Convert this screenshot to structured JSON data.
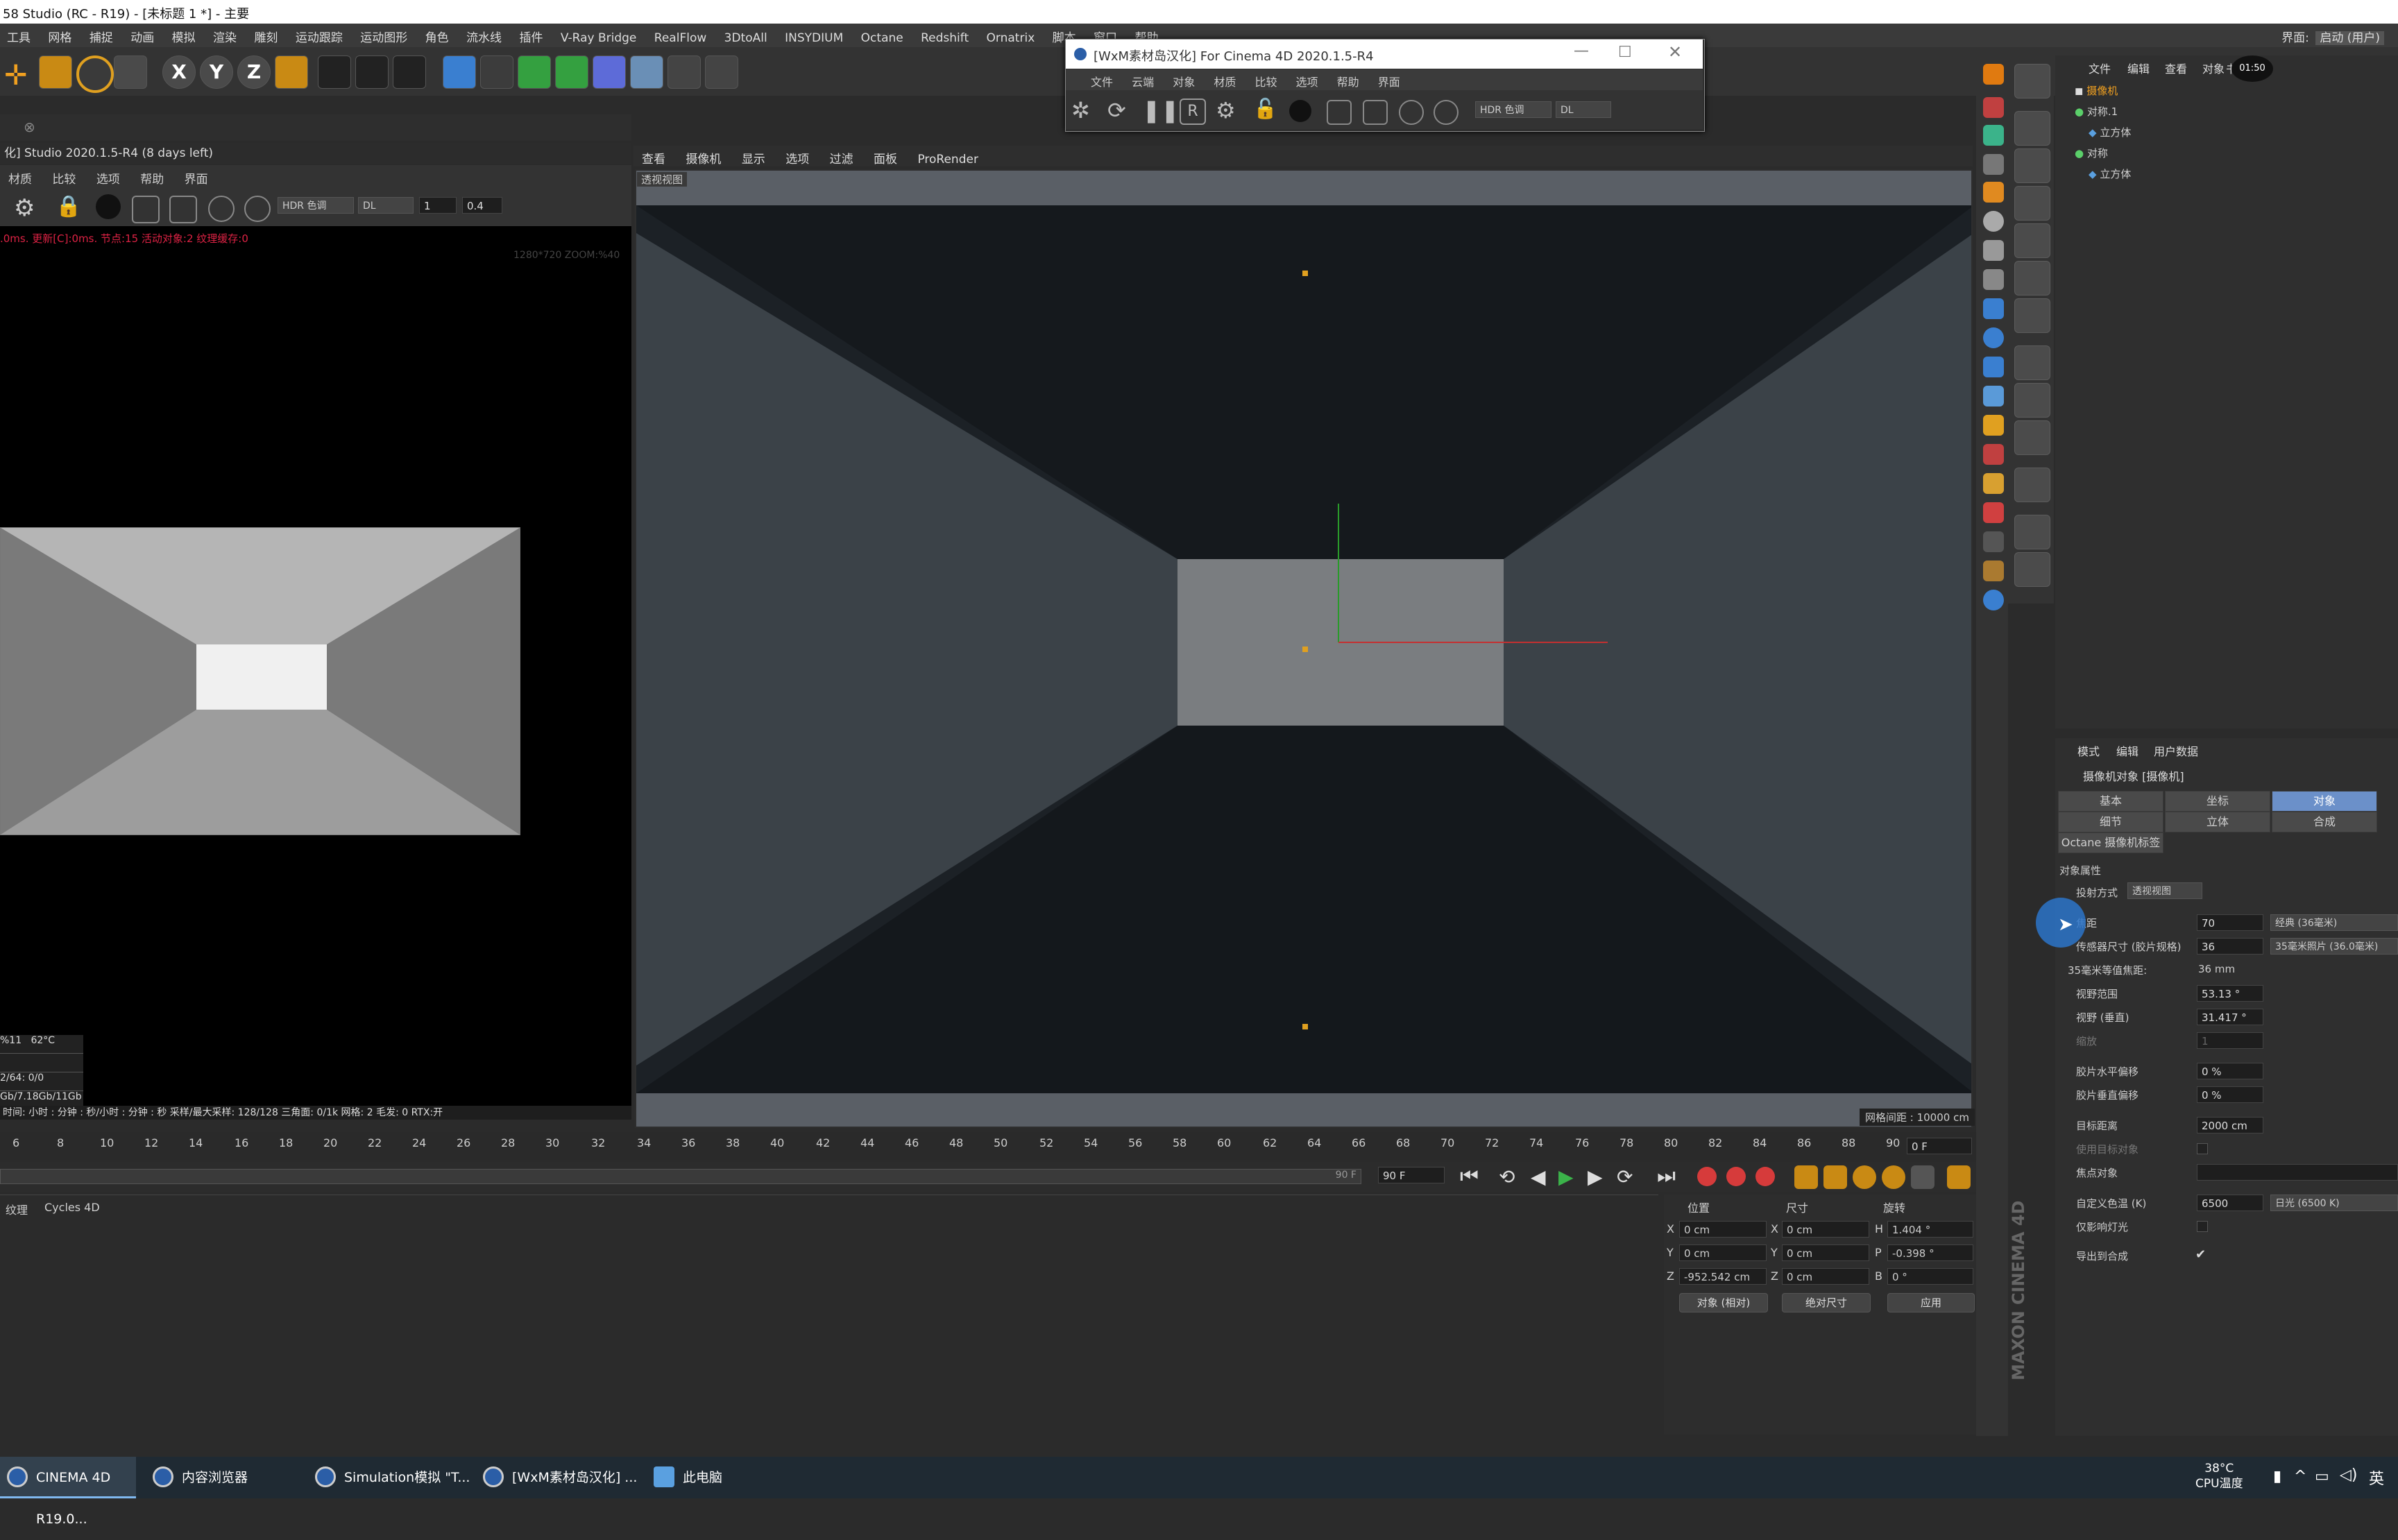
{
  "window": {
    "title": "58 Studio (RC - R19) - [未标题 1 *] - 主要"
  },
  "menubar": {
    "items": [
      "工具",
      "网格",
      "捕捉",
      "动画",
      "模拟",
      "渲染",
      "雕刻",
      "运动跟踪",
      "运动图形",
      "角色",
      "流水线",
      "插件",
      "V-Ray Bridge",
      "RealFlow",
      "3DtoAll",
      "INSYDIUM",
      "Octane",
      "Redshift",
      "Ornatrix",
      "脚本",
      "窗口",
      "帮助"
    ],
    "layout_label": "界面:",
    "layout_value": "启动 (用户)"
  },
  "toolbar": {
    "axis_labels": [
      "X",
      "Y",
      "Z"
    ]
  },
  "ipr": {
    "title": "化] Studio 2020.1.5-R4 (8 days left)",
    "menu": [
      "材质",
      "比较",
      "选项",
      "帮助",
      "界面"
    ],
    "tone_dropdown": "HDR 色调",
    "dl_dropdown": "DL",
    "num1": "1",
    "num2": "0.4",
    "status": ".0ms. 更新[C]:0ms. 节点:15 活动对象:2 纹理缓存:0",
    "zoom": "1280*720 ZOOM:%40",
    "stats": [
      {
        "a": "%11",
        "b": "62°C"
      },
      {
        "a": "",
        "b": ""
      },
      {
        "a": "2/64: 0/0",
        "b": ""
      },
      {
        "a": "Gb/7.18Gb/11Gb",
        "b": ""
      }
    ],
    "footer": "时间: 小时 : 分钟 : 秒/小时 : 分钟 : 秒   采样/最大采样: 128/128   三角面: 0/1k   网格: 2   毛发: 0   RTX:开"
  },
  "viewport": {
    "menu": [
      "查看",
      "摄像机",
      "显示",
      "选项",
      "过滤",
      "面板",
      "ProRender"
    ],
    "label": "透视视图",
    "grid_spacing": "网格间距 : 10000 cm"
  },
  "timeline": {
    "ticks": [
      "6",
      "8",
      "10",
      "12",
      "14",
      "16",
      "18",
      "20",
      "22",
      "24",
      "26",
      "28",
      "30",
      "32",
      "34",
      "36",
      "38",
      "40",
      "42",
      "44",
      "46",
      "48",
      "50",
      "52",
      "54",
      "56",
      "58",
      "60",
      "62",
      "64",
      "66",
      "68",
      "70",
      "72",
      "74",
      "76",
      "78",
      "80",
      "82",
      "84",
      "86",
      "88",
      "90"
    ],
    "current_frame": "0 F",
    "end_frame": "90 F",
    "end_field": "90 F"
  },
  "bottom": {
    "tabs": [
      "纹理",
      "Cycles 4D"
    ]
  },
  "coords": {
    "headers": [
      "位置",
      "尺寸",
      "旋转"
    ],
    "rows": [
      {
        "axis": "X",
        "pos": "0 cm",
        "size_axis": "X",
        "size": "0 cm",
        "rot_axis": "H",
        "rot": "1.404 °"
      },
      {
        "axis": "Y",
        "pos": "0 cm",
        "size_axis": "Y",
        "size": "0 cm",
        "rot_axis": "P",
        "rot": "-0.398 °"
      },
      {
        "axis": "Z",
        "pos": "-952.542 cm",
        "size_axis": "Z",
        "size": "0 cm",
        "rot_axis": "B",
        "rot": "0 °"
      }
    ],
    "mode": "对象 (相对)",
    "size_mode": "绝对尺寸",
    "apply": "应用"
  },
  "object_manager": {
    "menu": [
      "文件",
      "编辑",
      "查看",
      "对象",
      "书签"
    ],
    "clock": "01:50",
    "objects": [
      {
        "name": "摄像机",
        "indent": 0
      },
      {
        "name": "对称.1",
        "indent": 0
      },
      {
        "name": "立方体",
        "indent": 1
      },
      {
        "name": "对称",
        "indent": 0
      },
      {
        "name": "立方体",
        "indent": 1
      }
    ]
  },
  "attributes": {
    "menu": [
      "模式",
      "编辑",
      "用户数据"
    ],
    "title": "摄像机对象 [摄像机]",
    "tabs": [
      [
        "基本",
        "坐标",
        "对象"
      ],
      [
        "细节",
        "立体",
        "合成"
      ]
    ],
    "active_tab": "对象",
    "octane_tab": "Octane 摄像机标签",
    "section": "对象属性",
    "projection_label": "投射方式",
    "projection_value": "透视视图",
    "rows": [
      {
        "label": "焦距",
        "value": "70",
        "extra": "经典 (36毫米)"
      },
      {
        "label": "传感器尺寸 (胶片规格)",
        "value": "36",
        "extra": "35毫米照片 (36.0毫米)"
      },
      {
        "label": "35毫米等值焦距:",
        "value": "36 mm",
        "extra": ""
      },
      {
        "label": "视野范围",
        "value": "53.13 °",
        "extra": ""
      },
      {
        "label": "视野 (垂直)",
        "value": "31.417 °",
        "extra": ""
      },
      {
        "label": "缩放",
        "value": "1",
        "extra": ""
      },
      {
        "label": "胶片水平偏移",
        "value": "0 %",
        "extra": ""
      },
      {
        "label": "胶片垂直偏移",
        "value": "0 %",
        "extra": ""
      },
      {
        "label": "目标距离",
        "value": "2000 cm",
        "extra": ""
      },
      {
        "label": "使用目标对象",
        "value": "",
        "extra": ""
      },
      {
        "label": "焦点对象",
        "value": "",
        "extra": ""
      },
      {
        "label": "自定义色温 (K)",
        "value": "6500",
        "extra": "日光 (6500 K)"
      },
      {
        "label": "仅影响灯光",
        "value": "",
        "extra": ""
      },
      {
        "label": "导出到合成",
        "value": "✔",
        "extra": ""
      }
    ]
  },
  "float_window": {
    "title": "[WxM素材岛汉化] For Cinema 4D 2020.1.5-R4",
    "menu": [
      "文件",
      "云端",
      "对象",
      "材质",
      "比较",
      "选项",
      "帮助",
      "界面"
    ],
    "tone_dropdown": "HDR 色调",
    "dl_dropdown": "DL"
  },
  "taskbar": {
    "items": [
      "CINEMA 4D R19.0...",
      "内容浏览器",
      "Simulation模拟 \"T...",
      "[WxM素材岛汉化] ...",
      "此电脑"
    ],
    "temp": "38°C",
    "temp_label": "CPU温度"
  },
  "colors": {
    "accent": "#6b90c9",
    "cursor": "#2b74c9"
  }
}
